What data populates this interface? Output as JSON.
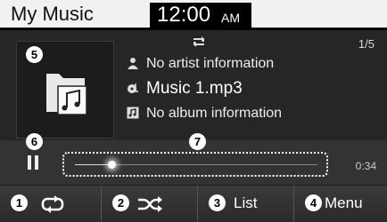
{
  "status_bar": {
    "app_title": "My Music",
    "time": "12:00",
    "ampm": "AM"
  },
  "now_playing": {
    "track_position": "1/5",
    "artist": "No artist information",
    "title": "Music 1.mp3",
    "album": "No album information",
    "elapsed": "0:34",
    "progress_fraction": 0.15
  },
  "callouts": [
    "1",
    "2",
    "3",
    "4",
    "5",
    "6",
    "7"
  ],
  "bottom_buttons": [
    {
      "number": "1",
      "icon": "repeat-icon",
      "label": ""
    },
    {
      "number": "2",
      "icon": "shuffle-icon",
      "label": ""
    },
    {
      "number": "3",
      "icon": "",
      "label": "List"
    },
    {
      "number": "4",
      "icon": "",
      "label": "Menu"
    }
  ],
  "colors": {
    "screen_bg": "#262626",
    "status_bg": "#f1f1f1",
    "accent": "#ffffff"
  }
}
